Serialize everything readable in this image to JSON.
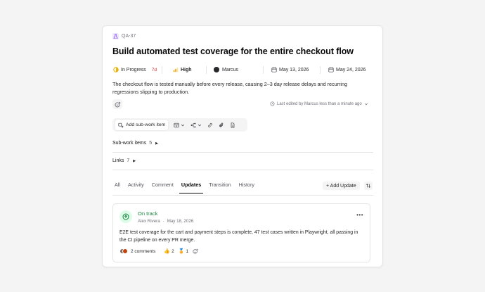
{
  "issue": {
    "id": "QA-37",
    "title": "Build automated test coverage for the entire checkout flow",
    "description": "The checkout flow is tested manually before every release, causing 2–3 day release delays and recurring regressions slipping to production.",
    "edited_text": "Last edited by Marcus less than a minute ago"
  },
  "properties": {
    "status": "In Progress",
    "status_age": "7d",
    "priority": "High",
    "assignee": "Marcus",
    "start_date": "May 13, 2026",
    "due_date": "May 24, 2026"
  },
  "toolbar": {
    "add_sub_item": "Add sub-work item"
  },
  "sections": {
    "subitems_label": "Sub-work items",
    "subitems_count": "5",
    "links_label": "Links",
    "links_count": "7"
  },
  "tabs": [
    "All",
    "Activity",
    "Comment",
    "Updates",
    "Transition",
    "History"
  ],
  "active_tab": "Updates",
  "add_update_label": "+ Add Update",
  "update": {
    "status": "On track",
    "author": "Alex Rivera",
    "date": "May 18, 2026",
    "body": "E2E test coverage for the cart and payment steps is complete, 47 test cases written in Playwright, all passing in the CI pipeline on every PR merge.",
    "comments": "2 comments",
    "reaction_thumbs": "2",
    "reaction_medal": "1"
  },
  "colors": {
    "status_icon": "#eab308",
    "status_age": "#dc2626",
    "priority": "#f59e0b",
    "on_track": "#15803d"
  },
  "icons": {
    "issue_type": "test-tube-icon",
    "status": "in-progress-icon",
    "priority": "signal-bars-icon",
    "assignee": "avatar",
    "start_date": "calendar-clock-icon",
    "due_date": "calendar-icon"
  }
}
